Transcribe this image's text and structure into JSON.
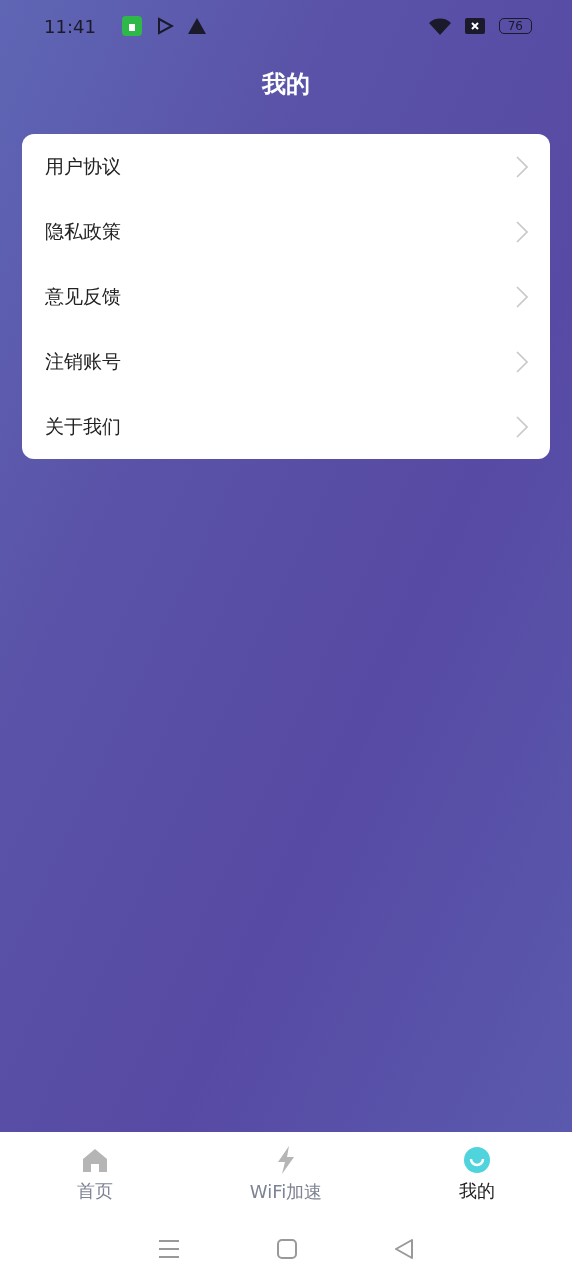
{
  "status_bar": {
    "time": "11:41",
    "battery": "76"
  },
  "title": "我的",
  "menu": [
    {
      "label": "用户协议"
    },
    {
      "label": "隐私政策"
    },
    {
      "label": "意见反馈"
    },
    {
      "label": "注销账号"
    },
    {
      "label": "关于我们"
    }
  ],
  "tabs": [
    {
      "label": "首页",
      "kind": "home",
      "selected": false
    },
    {
      "label": "WiFi加速",
      "kind": "bolt",
      "selected": false
    },
    {
      "label": "我的",
      "kind": "smile",
      "selected": true
    }
  ]
}
